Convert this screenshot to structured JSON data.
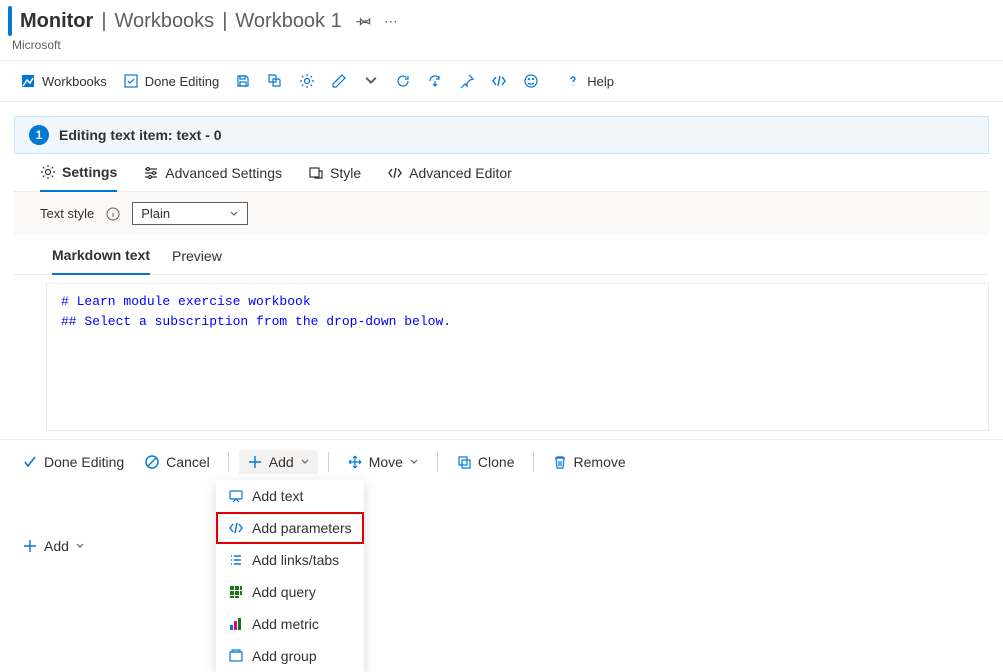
{
  "header": {
    "title": "Monitor",
    "crumb1": "Workbooks",
    "crumb2": "Workbook 1",
    "subtitle": "Microsoft"
  },
  "toolbar": {
    "workbooks": "Workbooks",
    "done_editing": "Done Editing",
    "help": "Help"
  },
  "banner": {
    "step": "1",
    "text": "Editing text item: text - 0"
  },
  "tabs": {
    "settings": "Settings",
    "advanced_settings": "Advanced Settings",
    "style": "Style",
    "advanced_editor": "Advanced Editor"
  },
  "style_row": {
    "label": "Text style",
    "value": "Plain"
  },
  "inner_tabs": {
    "markdown": "Markdown text",
    "preview": "Preview"
  },
  "editor": {
    "line1": "# Learn module exercise workbook",
    "line2": "## Select a subscription from the drop-down below."
  },
  "actions": {
    "done_editing": "Done Editing",
    "cancel": "Cancel",
    "add": "Add",
    "move": "Move",
    "clone": "Clone",
    "remove": "Remove"
  },
  "dropdown": {
    "add_text": "Add text",
    "add_parameters": "Add parameters",
    "add_links": "Add links/tabs",
    "add_query": "Add query",
    "add_metric": "Add metric",
    "add_group": "Add group"
  },
  "footer": {
    "add": "Add"
  }
}
